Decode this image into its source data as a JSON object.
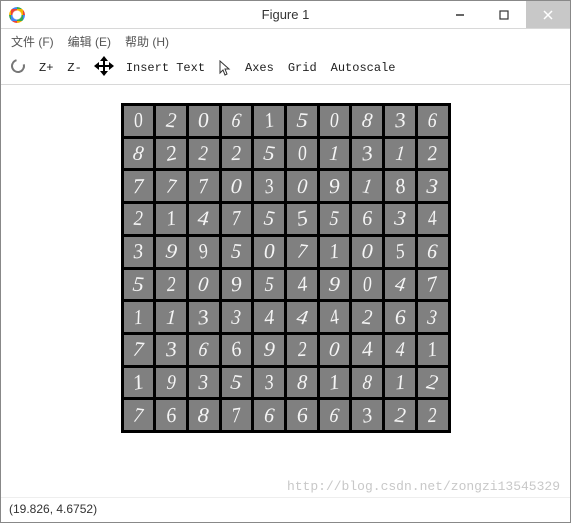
{
  "window": {
    "title": "Figure 1"
  },
  "menu": {
    "file": "文件 (F)",
    "edit": "编辑 (E)",
    "help": "帮助 (H)"
  },
  "toolbar": {
    "zoom_in": "Z+",
    "zoom_out": "Z-",
    "insert_text": "Insert Text",
    "axes": "Axes",
    "grid": "Grid",
    "autoscale": "Autoscale"
  },
  "chart_data": {
    "type": "heatmap",
    "title": "",
    "xlabel": "",
    "ylabel": "",
    "rows": 10,
    "cols": 10,
    "note": "10×10 grid of MNIST-style handwritten digit images; labels below are the depicted digit values",
    "values": [
      [
        0,
        2,
        0,
        6,
        1,
        5,
        0,
        8,
        3,
        6
      ],
      [
        8,
        2,
        2,
        2,
        5,
        0,
        1,
        3,
        1,
        2
      ],
      [
        7,
        7,
        7,
        0,
        3,
        0,
        9,
        1,
        8,
        3
      ],
      [
        2,
        1,
        4,
        7,
        5,
        5,
        5,
        6,
        3,
        4
      ],
      [
        3,
        9,
        9,
        5,
        0,
        7,
        1,
        0,
        5,
        6
      ],
      [
        5,
        2,
        0,
        9,
        5,
        4,
        9,
        0,
        4,
        7
      ],
      [
        1,
        1,
        3,
        3,
        4,
        4,
        4,
        2,
        6,
        3
      ],
      [
        7,
        3,
        6,
        6,
        9,
        2,
        0,
        4,
        4,
        1
      ],
      [
        1,
        9,
        3,
        5,
        3,
        8,
        1,
        8,
        1,
        2
      ],
      [
        7,
        6,
        8,
        7,
        6,
        6,
        6,
        3,
        2,
        2
      ]
    ]
  },
  "status": {
    "coords": "(19.826, 4.6752)"
  },
  "watermark": "http://blog.csdn.net/zongzi13545329"
}
